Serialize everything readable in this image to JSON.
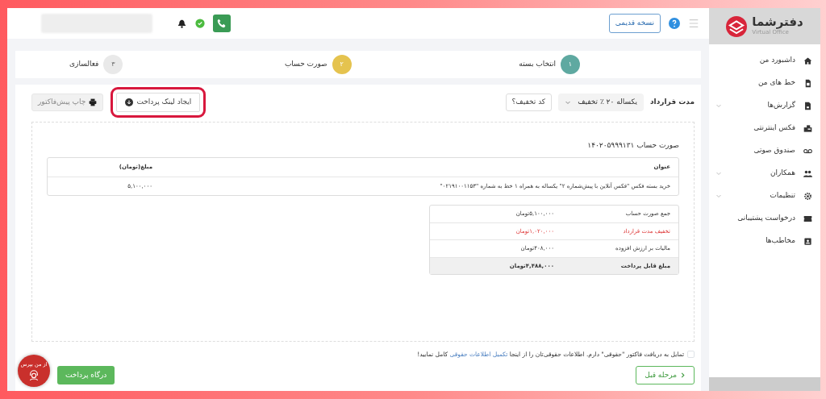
{
  "sidebar": {
    "logo": {
      "name": "دفترشما",
      "tagline": "Virtual Office"
    },
    "items": [
      {
        "label": "داشبورد من",
        "expandable": false
      },
      {
        "label": "خط های من",
        "expandable": false
      },
      {
        "label": "گزارش‌ها",
        "expandable": true
      },
      {
        "label": "فکس اینترنتی",
        "expandable": false
      },
      {
        "label": "صندوق صوتی",
        "expandable": false
      },
      {
        "label": "همکاران",
        "expandable": true
      },
      {
        "label": "تنظیمات",
        "expandable": true
      },
      {
        "label": "درخواست پشتیبانی",
        "expandable": false
      },
      {
        "label": "مخاطب‌ها",
        "expandable": false
      }
    ]
  },
  "header": {
    "old_version_button": "نسخه قدیمی"
  },
  "steps": [
    {
      "number": "۱",
      "label": "انتخاب بسته",
      "color": "#5fa9a1"
    },
    {
      "number": "۲",
      "label": "صورت حساب",
      "color": "#e5c34f"
    },
    {
      "number": "۳",
      "label": "فعالسازی",
      "color": "#e9e9e9"
    }
  ],
  "contract": {
    "label": "مدت قرارداد",
    "value": "یکساله ۲۰ ٪ تخفیف",
    "discount_button": "کد تخفیف؟"
  },
  "actions": {
    "create_link": {
      "label": "ایجاد لینک پرداخت",
      "highlighted": true
    },
    "print": "چاپ پیش‌فاکتور"
  },
  "invoice": {
    "title": "صورت حساب ۱۴۰۲۰۵۹۹۹۱۳۱",
    "columns": [
      "عنوان",
      "مبلغ(تومان)"
    ],
    "rows": [
      [
        "خرید بسته فکس \"فکس آنلاین با پیش‌شماره ۲\" یکساله به همراه ۱ خط به شماره \"۰۲۱۹۱۰۰۱۱۵۳\"",
        "۵,۱۰۰,۰۰۰"
      ]
    ],
    "summary": [
      {
        "label": "جمع صورت حساب",
        "value": "۵,۱۰۰,۰۰۰تومان",
        "kind": "normal"
      },
      {
        "label": "تخفیف مدت قرارداد",
        "value": "۱,۰۲۰,۰۰۰تومان",
        "kind": "discount"
      },
      {
        "label": "مالیات بر ارزش افزوده",
        "value": "۴۰۸,۰۰۰تومان",
        "kind": "normal"
      },
      {
        "label": "مبلغ قابل پرداخت",
        "value": "۴,۴۸۸,۰۰۰تومان",
        "kind": "total"
      }
    ]
  },
  "legal": {
    "checked": false,
    "text_before": "تمایل به دریافت فاکتور \"حقوقی\" دارم.  اطلاعات حقوقی‌تان را از اینجا",
    "link": "تکمیل اطلاعات حقوقی",
    "text_after": "کامل نمایید!"
  },
  "buttons": {
    "previous": "مرحله قبل",
    "pay": "درگاه پرداخت"
  },
  "chat": {
    "label": "از من بپرس"
  }
}
